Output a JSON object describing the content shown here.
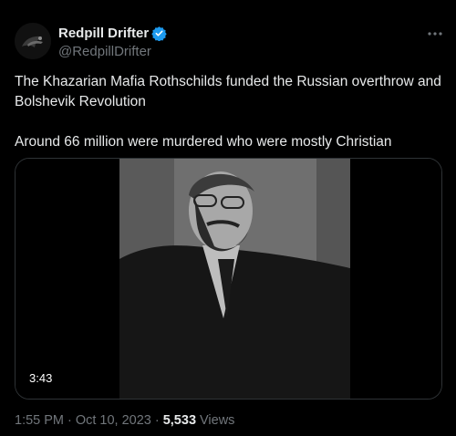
{
  "author": {
    "display_name": "Redpill Drifter",
    "handle": "@RedpillDrifter",
    "verified_badge_color": "#1d9bf0"
  },
  "icons": {
    "more": "more-icon",
    "verified": "verified-badge-icon"
  },
  "tweet": {
    "paragraphs": [
      "The Khazarian Mafia Rothschilds funded the Russian overthrow and Bolshevik Revolution",
      "Around 66 million were murdered who were mostly Christian"
    ]
  },
  "media": {
    "type": "video",
    "duration": "3:43"
  },
  "meta": {
    "time": "1:55 PM",
    "separator": "·",
    "date": "Oct 10, 2023",
    "views_count": "5,533",
    "views_label": "Views"
  },
  "colors": {
    "background": "#000000",
    "text": "#e7e9ea",
    "secondary": "#71767b",
    "border": "#2f3336"
  }
}
